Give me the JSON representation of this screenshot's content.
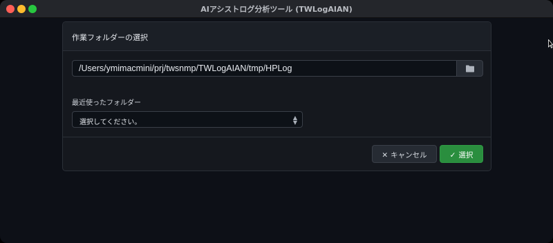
{
  "window": {
    "title": "AIアシストログ分析ツール (TWLogAIAN)"
  },
  "dialog": {
    "title": "作業フォルダーの選択",
    "folder_path": "/Users/ymimacmini/prj/twsnmp/TWLogAIAN/tmp/HPLog",
    "recent_label": "最近使ったフォルダー",
    "recent_select": {
      "selected": "選択してください。"
    },
    "cancel_label": "キャンセル",
    "ok_label": "選択"
  },
  "icons": {
    "browse": "folder-icon",
    "cancel": "close-icon",
    "ok": "check-icon",
    "select_caret": "chevron-updown-icon"
  },
  "colors": {
    "background": "#0d1017",
    "dialog": "#15181e",
    "primary": "#2a8e3e"
  }
}
